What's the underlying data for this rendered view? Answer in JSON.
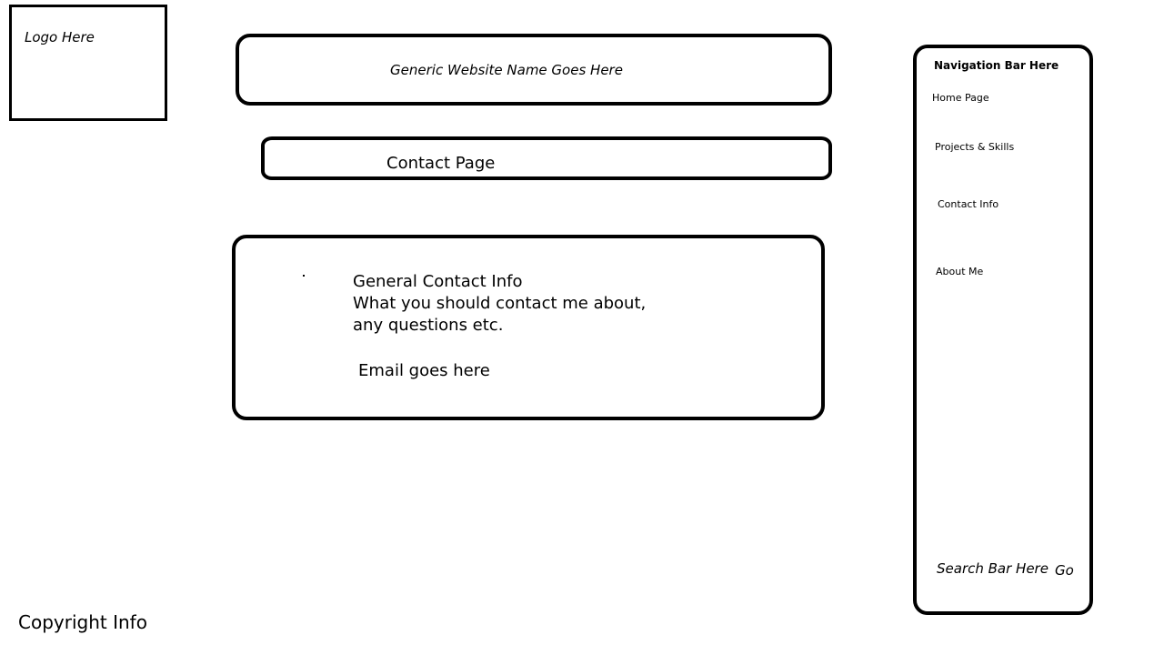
{
  "logo": {
    "text": "Logo Here"
  },
  "header": {
    "site_name": "Generic Website Name Goes Here"
  },
  "page": {
    "title": "Contact Page"
  },
  "content": {
    "heading": "General Contact Info",
    "body": "What you should contact me about, any questions etc.",
    "email": "Email goes here"
  },
  "nav": {
    "title": "Navigation Bar Here",
    "items": [
      {
        "label": "Home Page"
      },
      {
        "label": "Projects & Skills"
      },
      {
        "label": "Contact Info"
      },
      {
        "label": "About Me"
      }
    ],
    "search_label": "Search Bar Here",
    "go_label": "Go"
  },
  "footer": {
    "copyright": "Copyright Info"
  }
}
